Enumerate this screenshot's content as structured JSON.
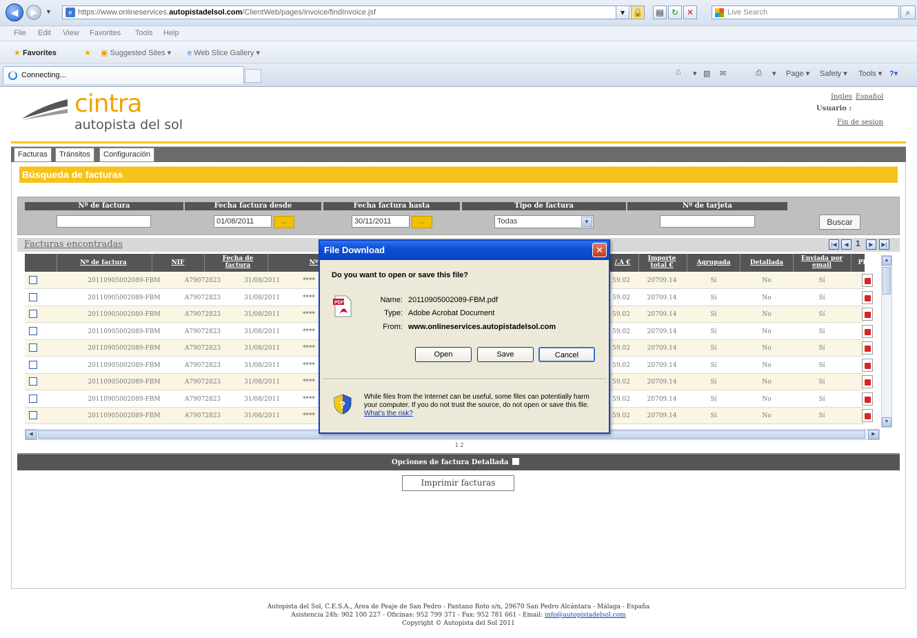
{
  "browser": {
    "url_prefix": "https://www.onlineservices.",
    "url_domain": "autopistadelsol.com",
    "url_path": "/ClientWeb/pages/invoice/findInvoice.jsf",
    "search_placeholder": "Live Search",
    "menu": [
      "File",
      "Edit",
      "View",
      "Favorites",
      "Tools",
      "Help"
    ],
    "favorites": {
      "label": "Favorites",
      "suggested": "Suggested Sites ▾",
      "webslice": "Web Slice Gallery ▾"
    },
    "tab_title": "Connecting...",
    "commands": {
      "page": "Page ▾",
      "safety": "Safety ▾",
      "tools": "Tools ▾"
    }
  },
  "header": {
    "logo_text": "cintra",
    "logo_sub": "autopista del sol",
    "lang_en": "Ingles",
    "lang_es": "Español",
    "usuario_label": "Usuario :",
    "logout": "Fin de sesion"
  },
  "nav": {
    "tabs": [
      "Facturas",
      "Tránsitos",
      "Configuración"
    ]
  },
  "section_title": "Búsqueda de facturas",
  "filters": {
    "num_factura": "Nº de factura",
    "fecha_desde": "Fecha factura desde",
    "fecha_desde_value": "01/08/2011",
    "fecha_hasta": "Fecha factura hasta",
    "fecha_hasta_value": "30/11/2011",
    "tipo": "Tipo de factura",
    "tipo_value": "Todas",
    "tarjeta": "Nº de tarjeta",
    "calendar_btn": "...",
    "buscar": "Buscar"
  },
  "results": {
    "title": "Facturas encontradas",
    "page": "1",
    "columns": {
      "num": "Nº de factura",
      "nif": "NIF",
      "fecha_l1": "Fecha de",
      "fecha_l2": "factura",
      "n_partial": "Nº",
      "iva_partial": "/.A €",
      "importe_l1": "Importe",
      "importe_l2": "total €",
      "agrupada": "Agrupada",
      "detallada": "Detallada",
      "enviada_l1": "Enviada por",
      "enviada_l2": "email",
      "pdf": "PDF"
    },
    "row": {
      "num": "20110905002089-FBM",
      "nif": "A79072823",
      "fecha": "31/08/2011",
      "masked": "****",
      "iva": "59.02",
      "importe": "20709.14",
      "agrupada": "Sí",
      "detallada": "No",
      "enviada": "Sí"
    },
    "page_count": "1 2"
  },
  "options": {
    "label": "Opciones de factura   Detallada",
    "print": "Imprimir facturas"
  },
  "footer": {
    "line1": "Autopista del Sol, C.E.S.A., Área de Peaje de San Pedro - Pantano Roto s/n, 29670 San Pedro Alcántara - Málaga - España",
    "line2_prefix": "Asistencia 24h: 902 100 227 - Oficinas: 952 799 371 - Fax: 952 781 661 - Email:",
    "email": "info@autopistadelsol.com",
    "line3": "Copyright © Autopista del Sol 2011"
  },
  "dialog": {
    "title": "File Download",
    "question": "Do you want to open or save this file?",
    "name_label": "Name:",
    "name_value": "20110905002089-FBM.pdf",
    "type_label": "Type:",
    "type_value": "Adobe Acrobat Document",
    "from_label": "From:",
    "from_value": "www.onlineservices.autopistadelsol.com",
    "open": "Open",
    "save": "Save",
    "cancel": "Cancel",
    "warning": "While files from the Internet can be useful, some files can potentially harm your computer. If you do not trust the source, do not open or save this file.",
    "risk_link": "What's the risk?"
  },
  "colors": {
    "accent_gold": "#f6c21b",
    "dialog_blue": "#0b44c4",
    "header_gray": "#555555"
  }
}
